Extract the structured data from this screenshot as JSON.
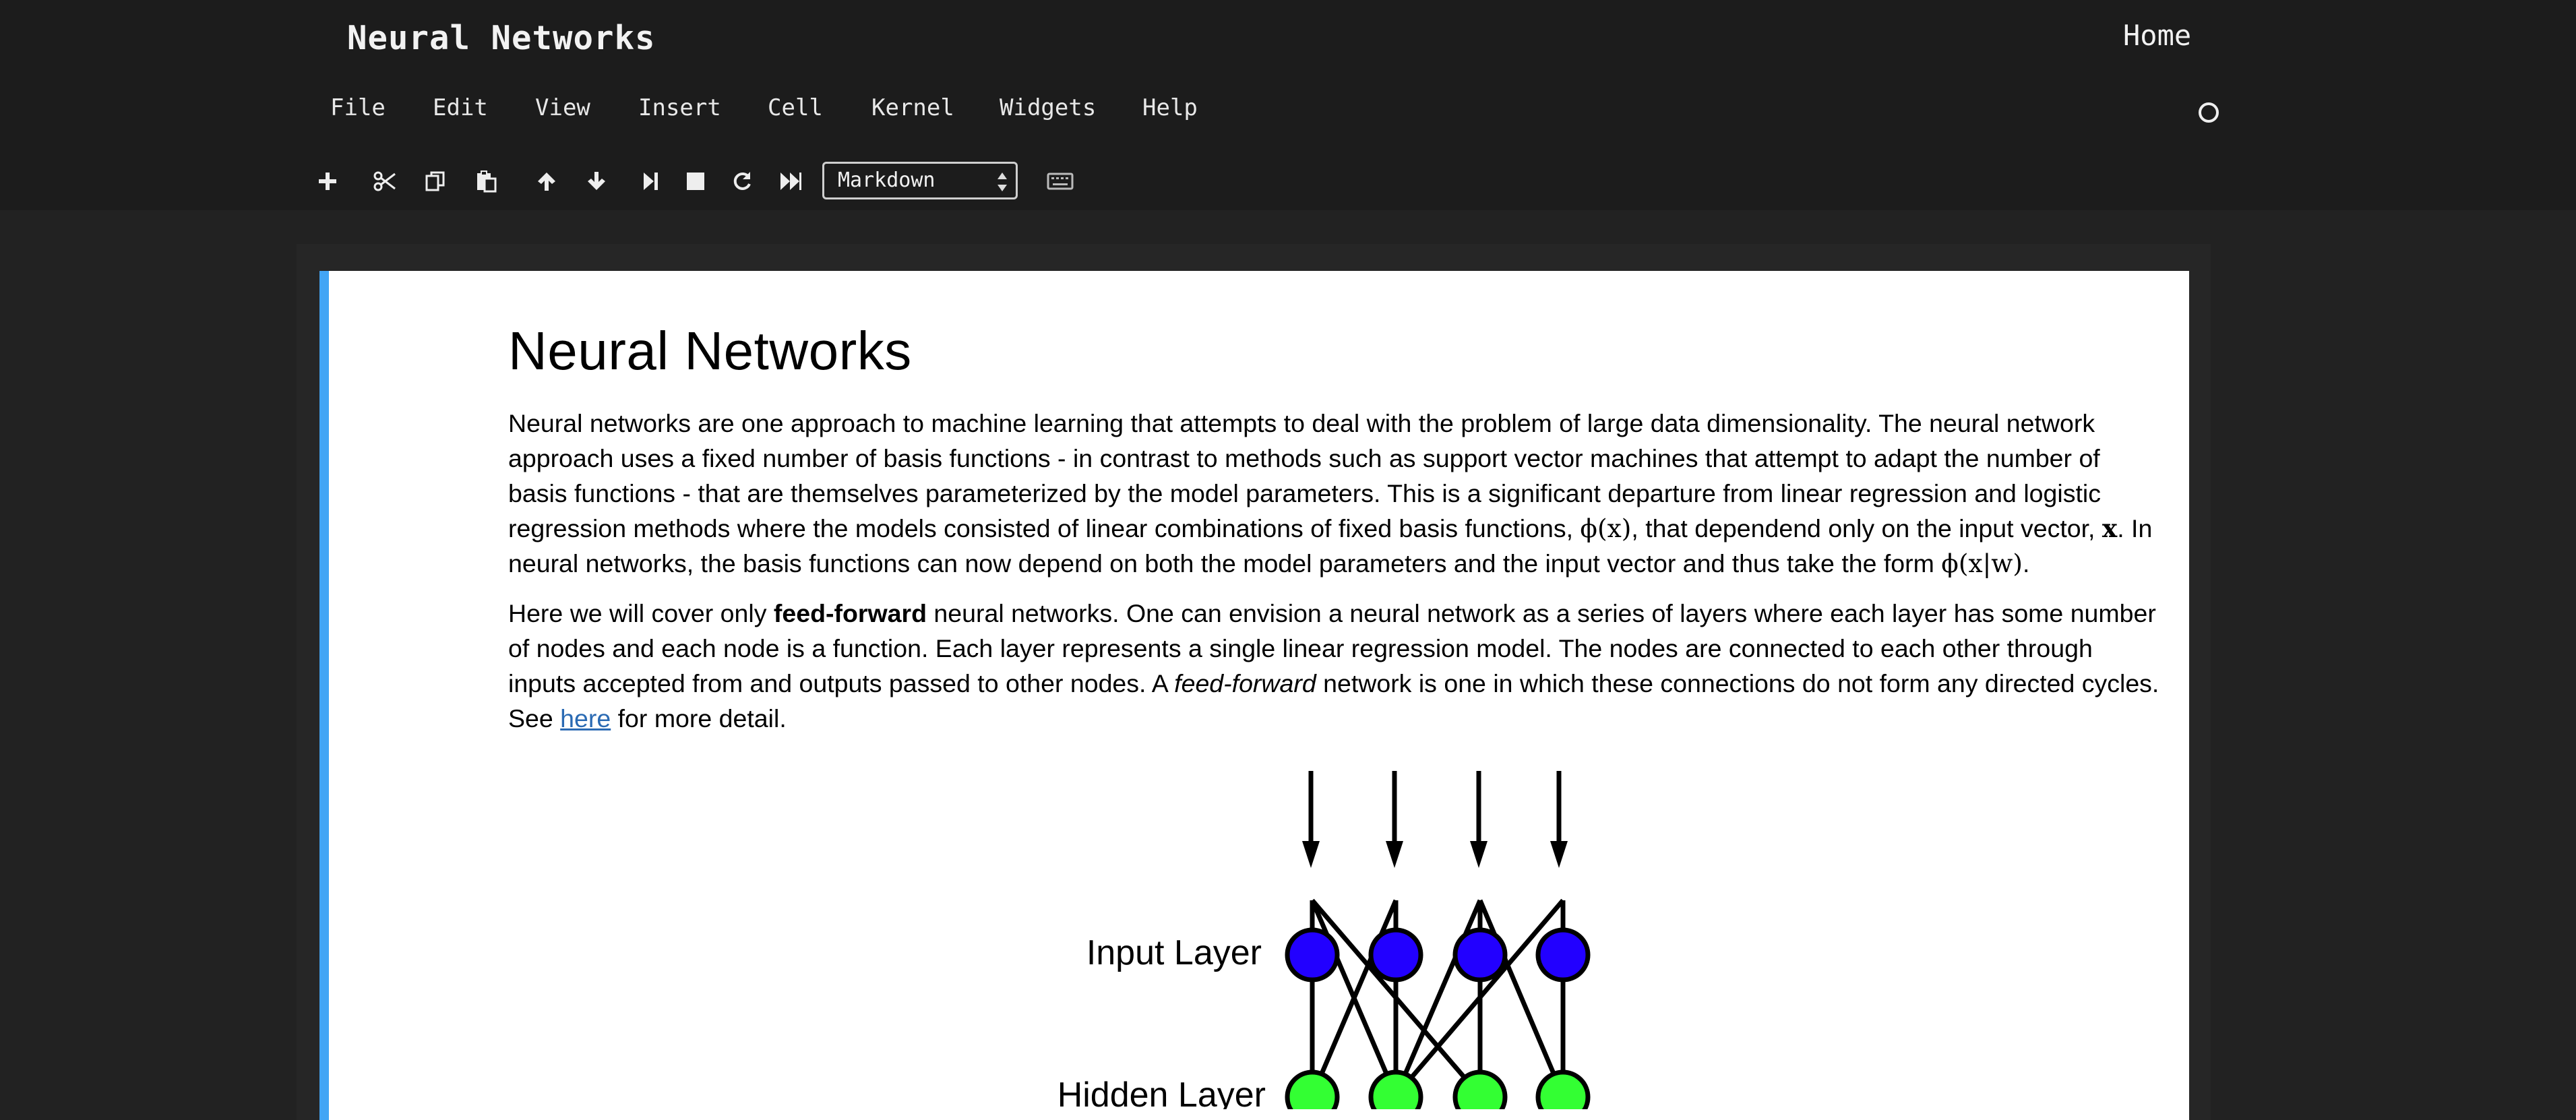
{
  "header": {
    "notebook_title": "Neural Networks",
    "home_label": "Home"
  },
  "menu": {
    "items": [
      "File",
      "Edit",
      "View",
      "Insert",
      "Cell",
      "Kernel",
      "Widgets",
      "Help"
    ]
  },
  "toolbar": {
    "buttons": [
      {
        "icon": "plus-icon",
        "action": "insert cell below"
      },
      {
        "icon": "scissors-icon",
        "action": "cut cells"
      },
      {
        "icon": "copy-icon",
        "action": "copy cells"
      },
      {
        "icon": "paste-icon",
        "action": "paste cells"
      },
      {
        "icon": "arrow-up-icon",
        "action": "move cell up"
      },
      {
        "icon": "arrow-down-icon",
        "action": "move cell down"
      },
      {
        "icon": "step-forward-icon",
        "action": "run"
      },
      {
        "icon": "stop-icon",
        "action": "interrupt kernel"
      },
      {
        "icon": "refresh-icon",
        "action": "restart kernel"
      },
      {
        "icon": "fast-forward-icon",
        "action": "restart and run all"
      },
      {
        "icon": "keyboard-icon",
        "action": "command palette"
      }
    ],
    "cell_type": "Markdown"
  },
  "colors": {
    "header_bg": "#1c1c1c",
    "page_bg": "#222222",
    "cell_selected_bar": "#42a5f5",
    "input_node": "#2200ff",
    "hidden_node": "#33ff33",
    "link": "#2a6ab3"
  },
  "cell": {
    "heading": "Neural Networks",
    "p1": {
      "a": "Neural networks are one approach to machine learning that attempts to deal with the problem of large data dimensionality. The neural network approach uses a fixed number of basis functions - in contrast to methods such as support vector machines that attempt to adapt the number of basis functions - that are themselves parameterized by the model parameters. This is a significant departure from linear regression and logistic regression methods where the models consisted of linear combinations of fixed basis functions, ",
      "math1": "ϕ(x)",
      "b": ", that dependend only on the input vector, ",
      "math2": "x",
      "c": ". In neural networks, the basis functions can now depend on both the model parameters and the input vector and thus take the form ",
      "math3": "ϕ(x|w)",
      "d": "."
    },
    "p2": {
      "a": "Here we will cover only ",
      "bold": "feed-forward",
      "b": " neural networks. One can envision a neural network as a series of layers where each layer has some number of nodes and each node is a function. Each layer represents a single linear regression model. The nodes are connected to each other through inputs accepted from and outputs passed to other nodes. A ",
      "italic": "feed-forward",
      "c": " network is one in which these connections do not form any directed cycles. See ",
      "link": "here",
      "d": " for more detail."
    },
    "figure": {
      "input_label": "Input Layer",
      "hidden_label": "Hidden Layer"
    }
  }
}
